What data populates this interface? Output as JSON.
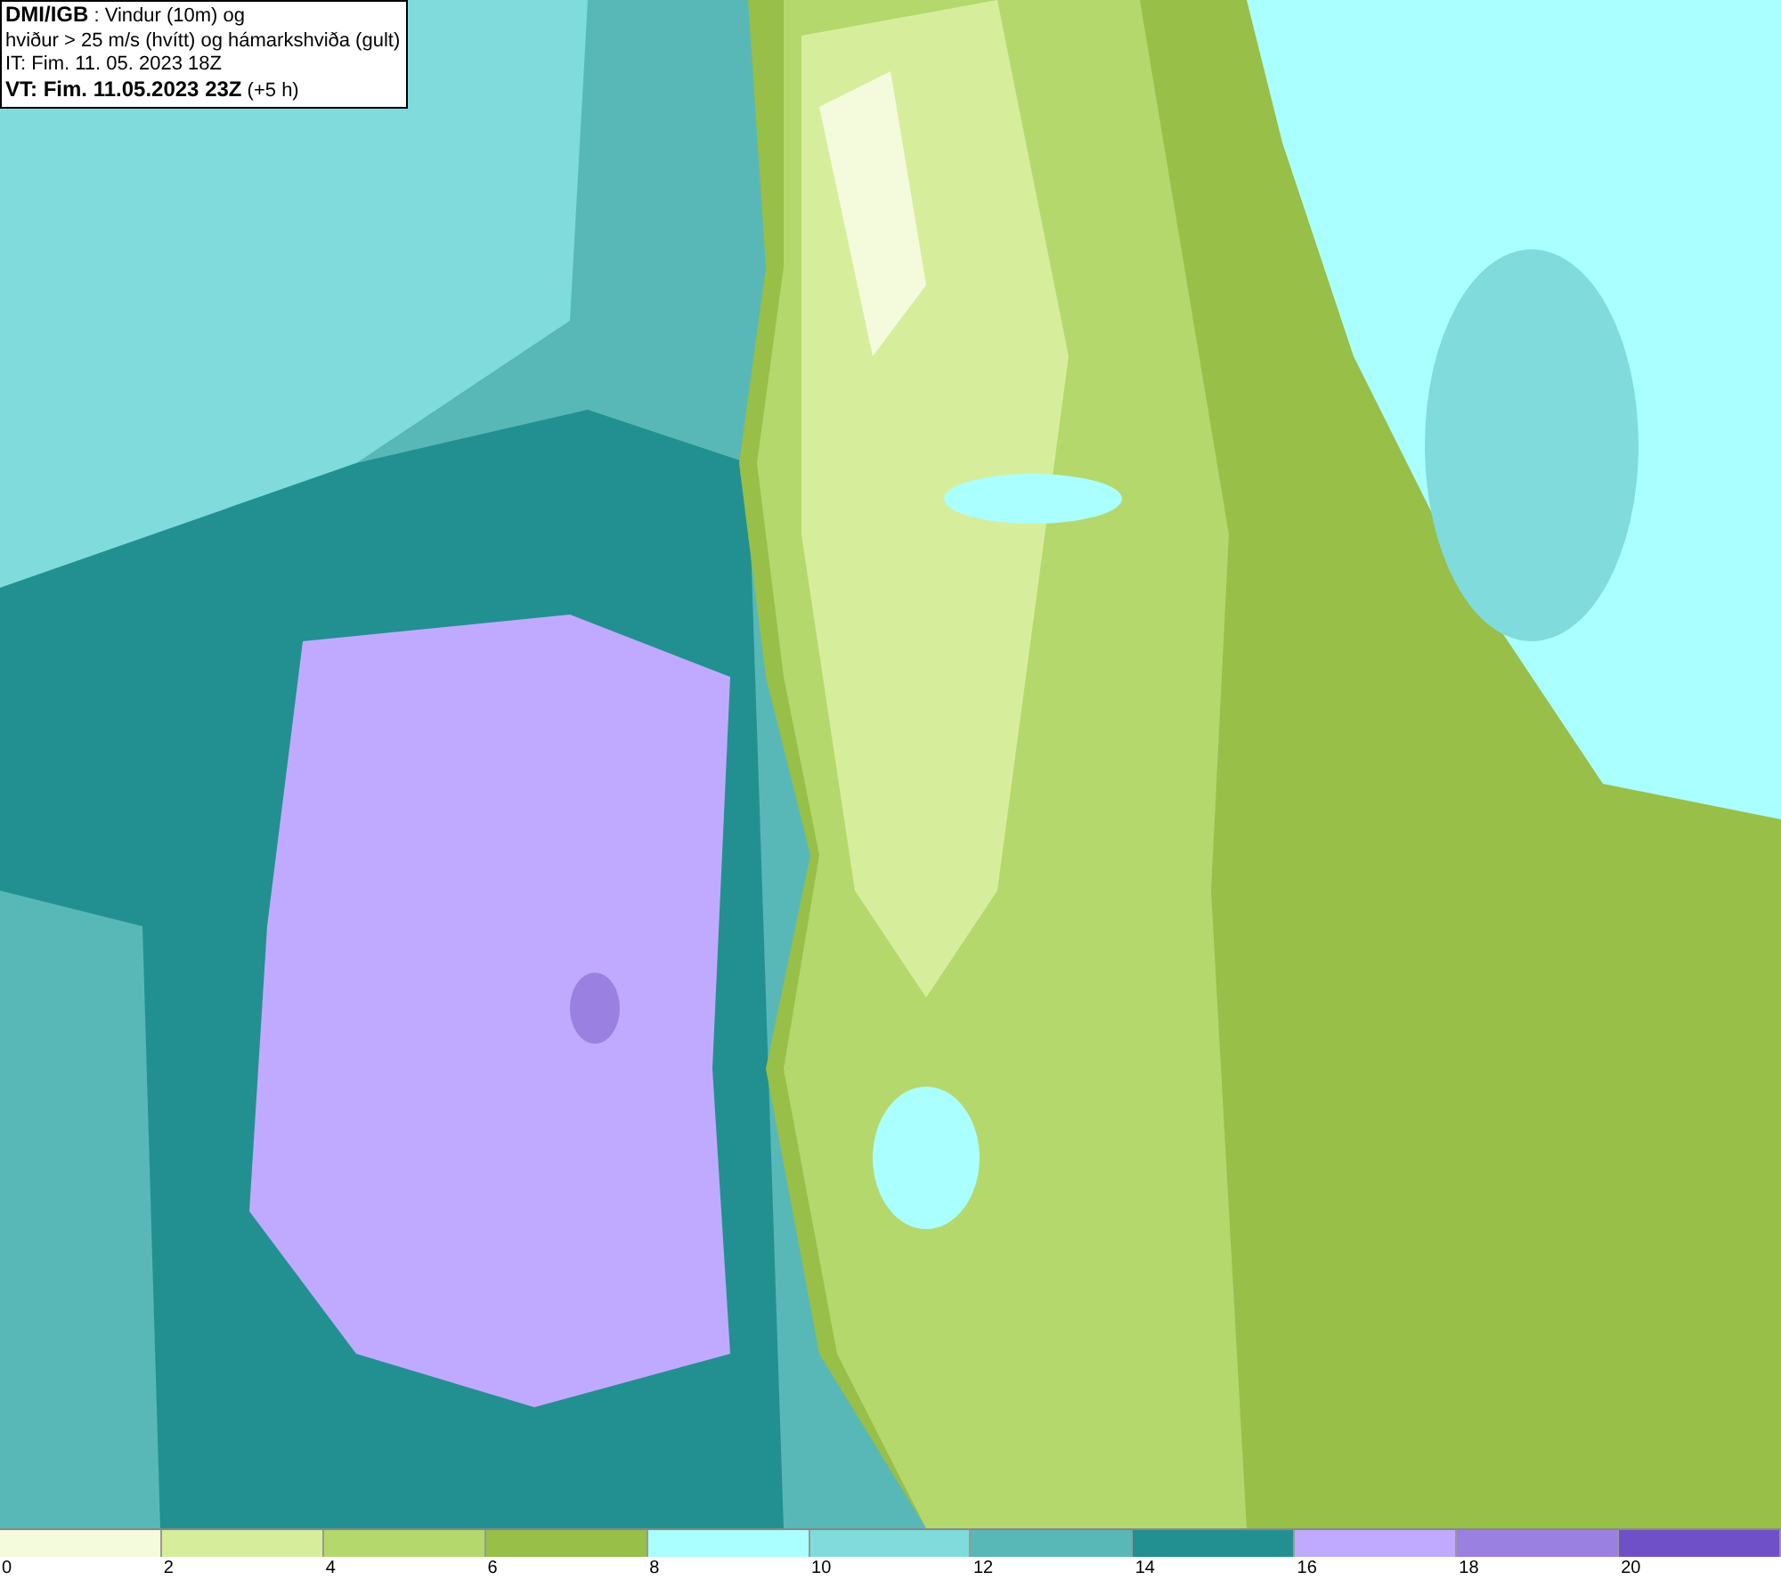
{
  "info_box": {
    "lines": [
      "**DMI/IGB** : Vindur (10m) og",
      "hviður > 25 m/s (hvítt) og hámarkshviða (gult)",
      "IT: Fim. 11. 05. 2023 18Z",
      "**VT: Fim. 11.05.2023 23Z** (+5 h)"
    ]
  },
  "legend": {
    "swatches": [
      {
        "color": "#f4fbdc"
      },
      {
        "color": "#d6ee9c"
      },
      {
        "color": "#b4d86c"
      },
      {
        "color": "#98bf48"
      },
      {
        "color": "#aaffff"
      },
      {
        "color": "#80dcdc"
      },
      {
        "color": "#58b8b8"
      },
      {
        "color": "#229090"
      },
      {
        "color": "#c0aaff"
      },
      {
        "color": "#9a80e0"
      },
      {
        "color": "#7050c8"
      }
    ],
    "ticks": [
      "0",
      "2",
      "4",
      "6",
      "8",
      "10",
      "12",
      "14",
      "16",
      "18",
      "20"
    ]
  }
}
